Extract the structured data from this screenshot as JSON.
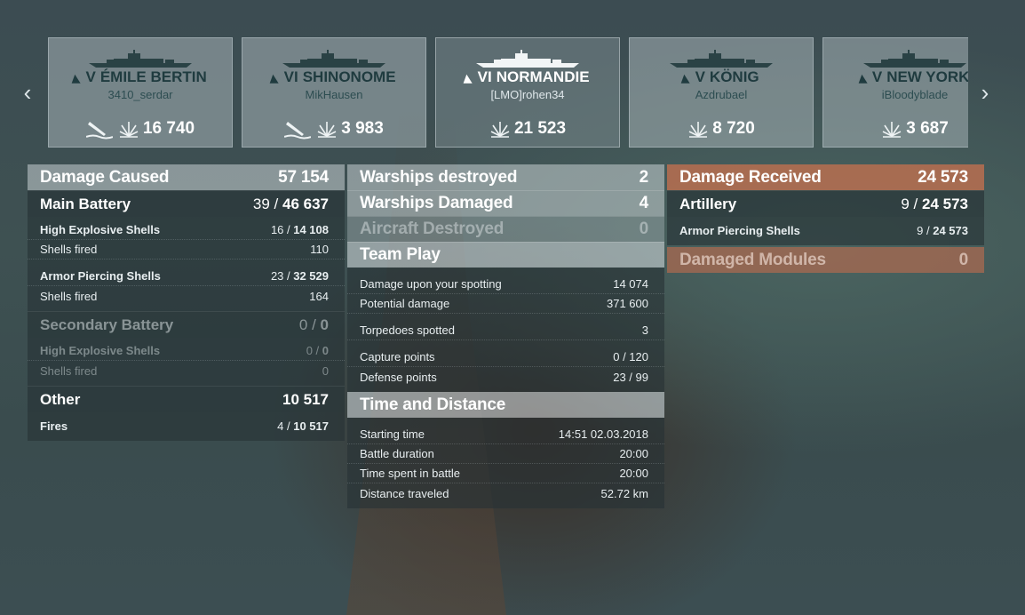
{
  "nav": {
    "prev_icon": "chevron-left-icon",
    "next_icon": "chevron-right-icon"
  },
  "ships": [
    {
      "tier": "V",
      "name": "ÉMILE BERTIN",
      "player": "3410_serdar",
      "damage": "16 740",
      "sunk": true,
      "selected": false
    },
    {
      "tier": "VI",
      "name": "SHINONOME",
      "player": "MikHausen",
      "damage": "3 983",
      "sunk": true,
      "selected": false
    },
    {
      "tier": "VI",
      "name": "NORMANDIE",
      "player": "[LMO]rohen34",
      "damage": "21 523",
      "sunk": false,
      "selected": true
    },
    {
      "tier": "V",
      "name": "KÖNIG",
      "player": "Azdrubael",
      "damage": "8 720",
      "sunk": false,
      "selected": false
    },
    {
      "tier": "V",
      "name": "NEW YORK",
      "player": "iBloodyblade",
      "damage": "3 687",
      "sunk": false,
      "selected": false
    }
  ],
  "damage_caused": {
    "title": "Damage Caused",
    "total": "57 154",
    "main_battery": {
      "label": "Main Battery",
      "hits": "39",
      "value": "46 637"
    },
    "main_rows": [
      {
        "label": "High Explosive Shells",
        "hits": "16",
        "value": "14 108"
      },
      {
        "label": "Shells fired",
        "value": "110"
      },
      {
        "label": "Armor Piercing Shells",
        "hits": "23",
        "value": "32 529"
      },
      {
        "label": "Shells fired",
        "value": "164"
      }
    ],
    "secondary_battery": {
      "label": "Secondary Battery",
      "hits": "0",
      "value": "0"
    },
    "secondary_rows": [
      {
        "label": "High Explosive Shells",
        "hits": "0",
        "value": "0"
      },
      {
        "label": "Shells fired",
        "value": "0"
      }
    ],
    "other": {
      "label": "Other",
      "value": "10 517"
    },
    "other_rows": [
      {
        "label": "Fires",
        "hits": "4",
        "value": "10 517"
      }
    ]
  },
  "middle": {
    "warships_destroyed": {
      "label": "Warships destroyed",
      "value": "2"
    },
    "warships_damaged": {
      "label": "Warships Damaged",
      "value": "4"
    },
    "aircraft_destroyed": {
      "label": "Aircraft Destroyed",
      "value": "0"
    },
    "team_play": {
      "title": "Team Play",
      "rows": [
        {
          "label": "Damage upon your spotting",
          "value": "14 074"
        },
        {
          "label": "Potential damage",
          "value": "371 600"
        },
        {
          "label": "Torpedoes spotted",
          "value": "3"
        },
        {
          "label": "Capture points",
          "value": "0 / 120"
        },
        {
          "label": "Defense points",
          "value": "23 / 99"
        }
      ]
    },
    "time_distance": {
      "title": "Time and Distance",
      "rows": [
        {
          "label": "Starting time",
          "value": "14:51   02.03.2018"
        },
        {
          "label": "Battle duration",
          "value": "20:00"
        },
        {
          "label": "Time spent in battle",
          "value": "20:00"
        },
        {
          "label": "Distance traveled",
          "value": "52.72 km"
        }
      ]
    }
  },
  "damage_received": {
    "title": "Damage Received",
    "total": "24 573",
    "artillery": {
      "label": "Artillery",
      "hits": "9",
      "value": "24 573"
    },
    "rows": [
      {
        "label": "Armor Piercing Shells",
        "hits": "9",
        "value": "24 573"
      }
    ],
    "damaged_modules": {
      "label": "Damaged Modules",
      "value": "0"
    }
  },
  "colors": {
    "received_accent": "#b96e50",
    "text_light": "#ffffff"
  }
}
